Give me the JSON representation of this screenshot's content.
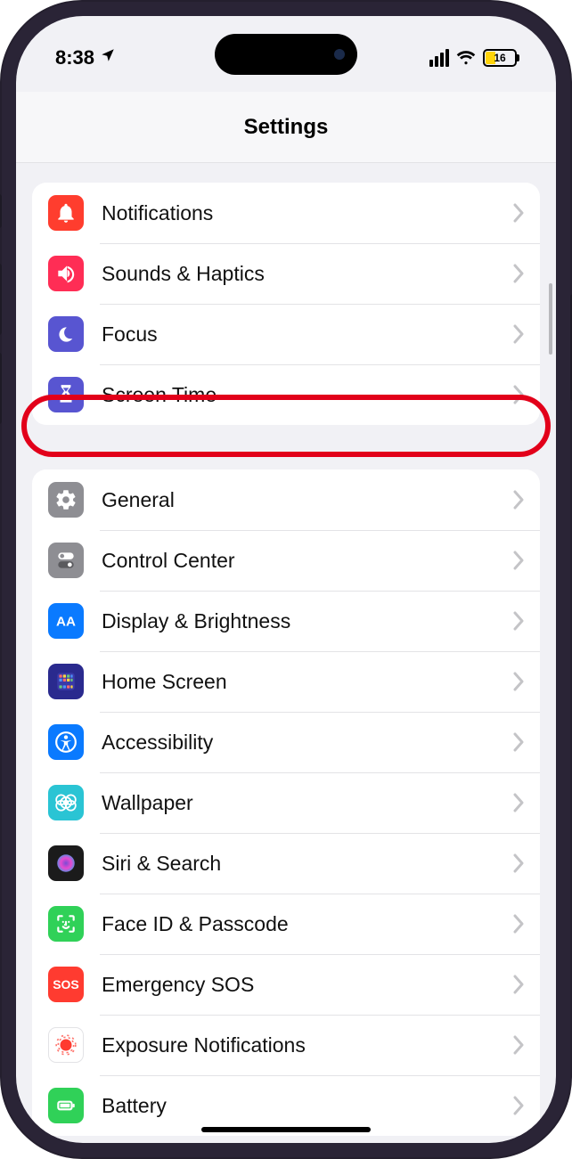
{
  "status": {
    "time": "8:38",
    "battery_pct": "16"
  },
  "header": {
    "title": "Settings"
  },
  "icon_colors": {
    "notifications": "#ff3d2e",
    "sounds": "#ff2d55",
    "focus": "#5855d1",
    "screentime": "#5855d1",
    "general": "#8e8e93",
    "controlcenter": "#8e8e93",
    "display": "#0a7aff",
    "homescreen": "#2a2a8e",
    "accessibility": "#0a7aff",
    "wallpaper": "#2ac4d4",
    "siri": "#1b1b1b",
    "faceid": "#30d158",
    "sos": "#ff3b30",
    "exposure": "#ffffff",
    "battery": "#30d158"
  },
  "groups": [
    {
      "items": [
        {
          "label": "Notifications",
          "icon": "notifications-icon",
          "colorKey": "notifications"
        },
        {
          "label": "Sounds & Haptics",
          "icon": "sounds-icon",
          "colorKey": "sounds"
        },
        {
          "label": "Focus",
          "icon": "focus-icon",
          "colorKey": "focus",
          "highlighted": true
        },
        {
          "label": "Screen Time",
          "icon": "screentime-icon",
          "colorKey": "screentime"
        }
      ]
    },
    {
      "items": [
        {
          "label": "General",
          "icon": "general-icon",
          "colorKey": "general"
        },
        {
          "label": "Control Center",
          "icon": "controlcenter-icon",
          "colorKey": "controlcenter"
        },
        {
          "label": "Display & Brightness",
          "icon": "display-icon",
          "colorKey": "display"
        },
        {
          "label": "Home Screen",
          "icon": "homescreen-icon",
          "colorKey": "homescreen"
        },
        {
          "label": "Accessibility",
          "icon": "accessibility-icon",
          "colorKey": "accessibility"
        },
        {
          "label": "Wallpaper",
          "icon": "wallpaper-icon",
          "colorKey": "wallpaper"
        },
        {
          "label": "Siri & Search",
          "icon": "siri-icon",
          "colorKey": "siri"
        },
        {
          "label": "Face ID & Passcode",
          "icon": "faceid-icon",
          "colorKey": "faceid"
        },
        {
          "label": "Emergency SOS",
          "icon": "sos-icon",
          "colorKey": "sos"
        },
        {
          "label": "Exposure Notifications",
          "icon": "exposure-icon",
          "colorKey": "exposure"
        },
        {
          "label": "Battery",
          "icon": "battery-icon",
          "colorKey": "battery"
        }
      ]
    }
  ],
  "sos_text": "SOS"
}
